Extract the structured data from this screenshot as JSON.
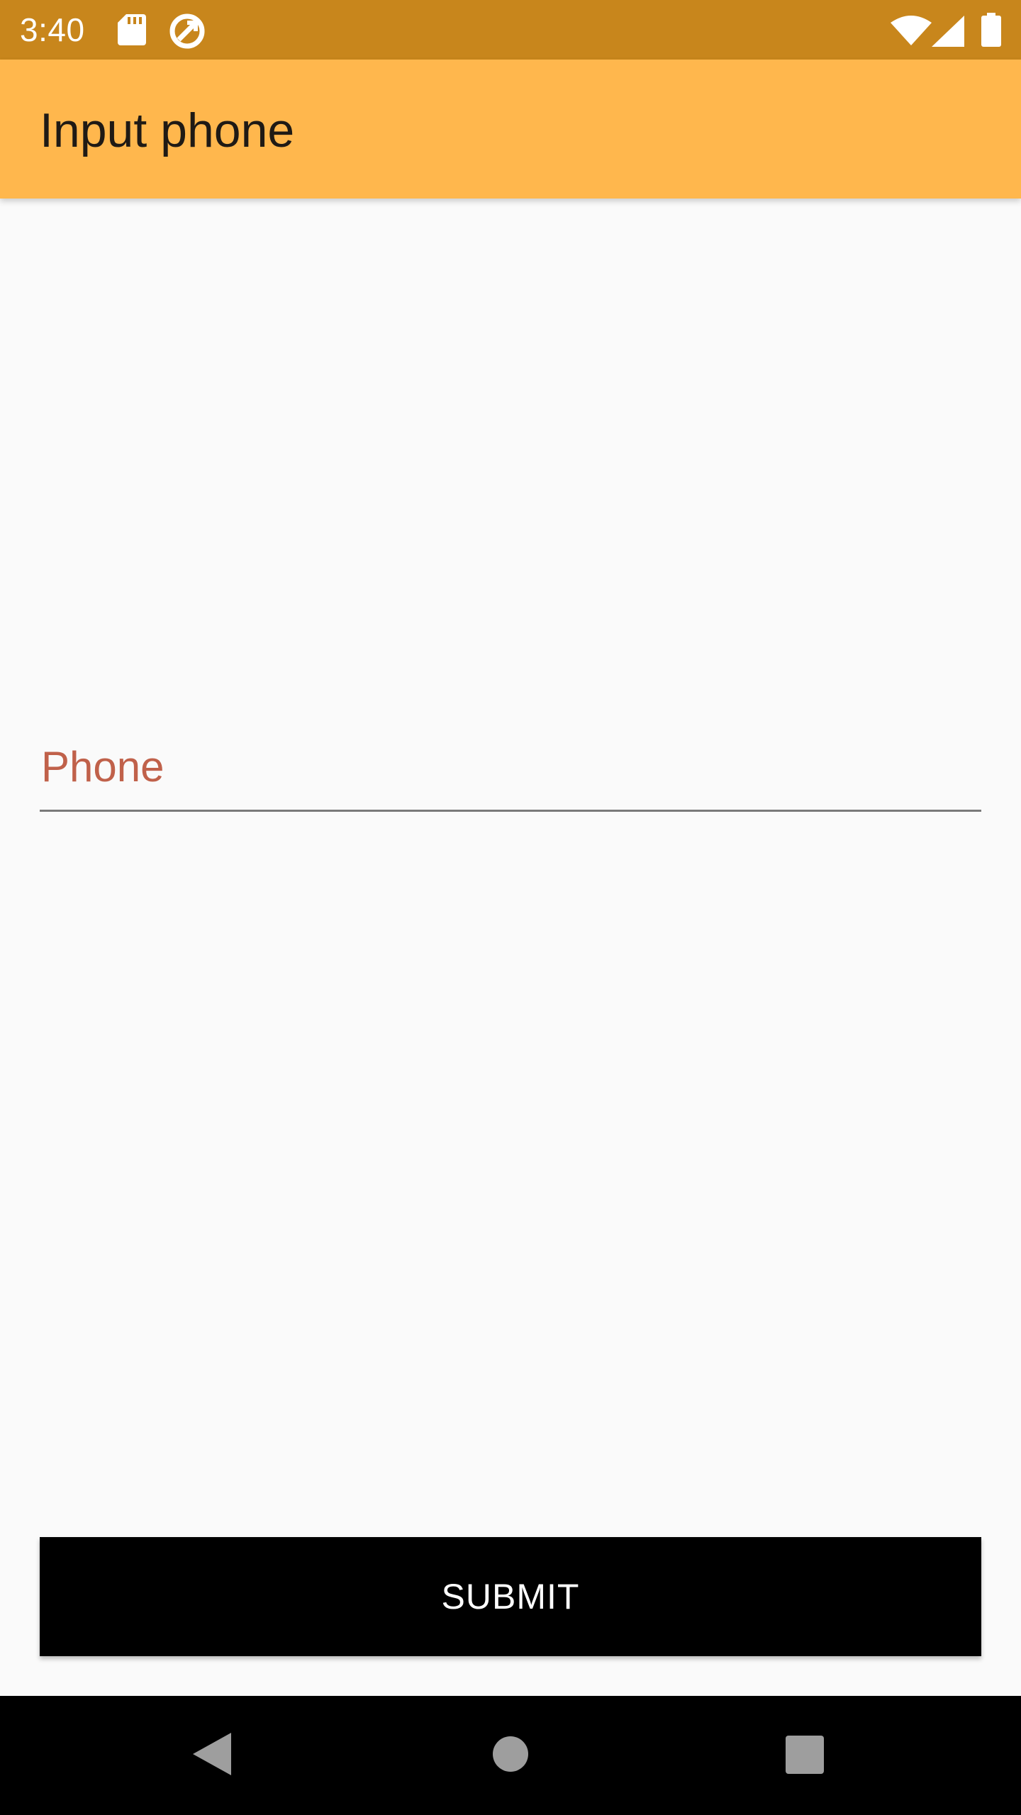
{
  "status_bar": {
    "time": "3:40",
    "icons": [
      "sd-card-icon",
      "sync-app-icon",
      "wifi-icon",
      "cellular-signal-icon",
      "battery-icon"
    ]
  },
  "app_bar": {
    "title": "Input phone"
  },
  "form": {
    "phone_placeholder": "Phone",
    "phone_value": "",
    "submit_label": "SUBMIT"
  },
  "nav_bar": {
    "buttons": [
      "back-icon",
      "home-icon",
      "recents-icon"
    ]
  },
  "colors": {
    "status_bar": "#C8861C",
    "app_bar": "#FFB74D",
    "placeholder": "#C0614A",
    "button": "#000000"
  }
}
